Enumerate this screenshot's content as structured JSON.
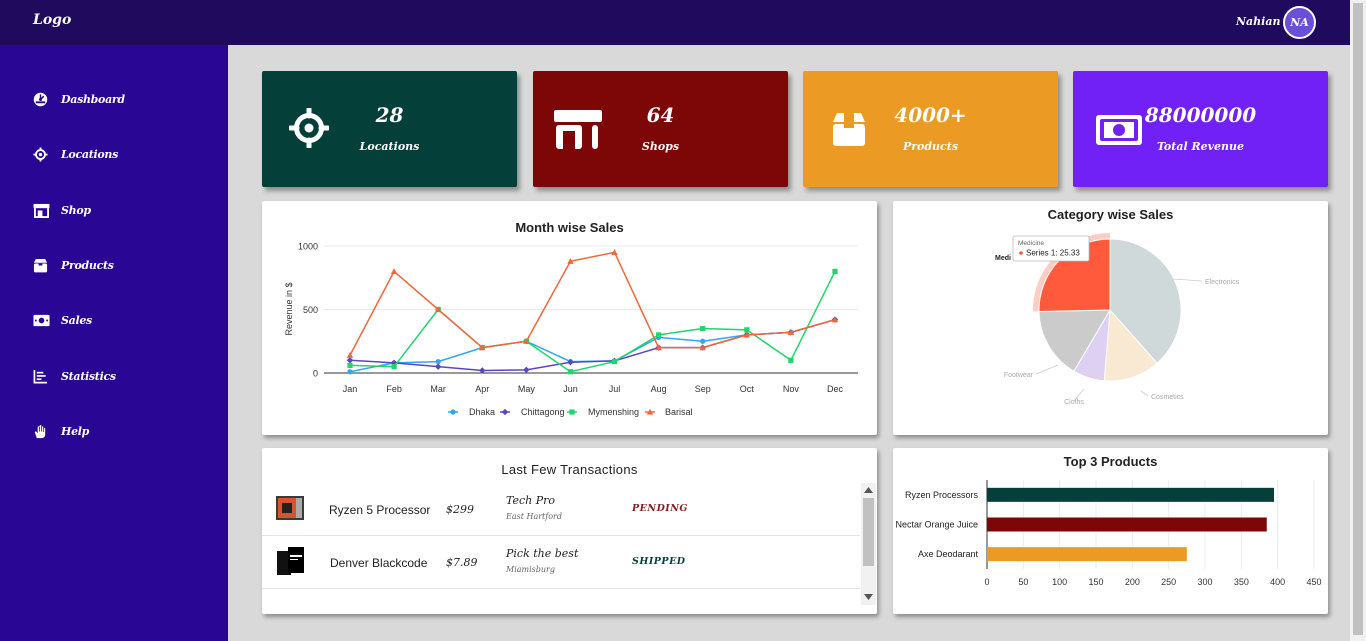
{
  "header": {
    "logo": "Logo",
    "user_name": "Nahian",
    "avatar_initials": "NA"
  },
  "sidebar": {
    "items": [
      {
        "label": "Dashboard",
        "icon": "dashboard-gauge-icon"
      },
      {
        "label": "Locations",
        "icon": "location-target-icon"
      },
      {
        "label": "Shop",
        "icon": "shop-icon"
      },
      {
        "label": "Products",
        "icon": "box-icon"
      },
      {
        "label": "Sales",
        "icon": "money-icon"
      },
      {
        "label": "Statistics",
        "icon": "chart-icon"
      },
      {
        "label": "Help",
        "icon": "hand-icon"
      }
    ]
  },
  "stats": [
    {
      "value": "28",
      "label": "Locations",
      "color": "#053f3a",
      "icon": "location-target-icon"
    },
    {
      "value": "64",
      "label": "Shops",
      "color": "#7d0606",
      "icon": "shop-icon"
    },
    {
      "value": "4000+",
      "label": "Products",
      "color": "#eb9b23",
      "icon": "box-icon"
    },
    {
      "value": "88000000",
      "label": "Total Revenue",
      "color": "#7121f5",
      "icon": "money-icon"
    }
  ],
  "colors": {
    "topbar": "#1f0a5e",
    "sidebar": "#2a0695",
    "background": "#d9d9d9"
  },
  "transactions": {
    "title": "Last Few Transactions",
    "rows": [
      {
        "product": "Ryzen 5 Processor",
        "price": "$299",
        "customer": "Tech Pro",
        "city": "East Hartford",
        "status": "PENDING",
        "status_color": "#8b1a1a"
      },
      {
        "product": "Denver Blackcode",
        "price": "$7.89",
        "customer": "Pick the best",
        "city": "Miamisburg",
        "status": "SHIPPED",
        "status_color": "#063f3a"
      }
    ]
  },
  "chart_data": [
    {
      "type": "line",
      "title": "Month wise Sales",
      "ylabel": "Revenue in $",
      "xlabel": "",
      "ylim": [
        0,
        1000
      ],
      "yticks": [
        0,
        500,
        1000
      ],
      "categories": [
        "Jan",
        "Feb",
        "Mar",
        "Apr",
        "May",
        "Jun",
        "Jul",
        "Aug",
        "Sep",
        "Oct",
        "Nov",
        "Dec"
      ],
      "legend": "bottom",
      "grid": true,
      "series": [
        {
          "name": "Dhaka",
          "color": "#2ea8f0",
          "marker": "circle",
          "values": [
            10,
            80,
            90,
            200,
            250,
            90,
            95,
            280,
            250,
            300,
            320,
            420
          ]
        },
        {
          "name": "Chittagong",
          "color": "#5a46c2",
          "marker": "diamond",
          "values": [
            100,
            80,
            50,
            20,
            25,
            85,
            95,
            200,
            200,
            300,
            320,
            420
          ]
        },
        {
          "name": "Mymenshing",
          "color": "#1ed66a",
          "marker": "square",
          "values": [
            60,
            50,
            500,
            200,
            250,
            10,
            90,
            300,
            350,
            340,
            100,
            800
          ]
        },
        {
          "name": "Barisal",
          "color": "#f0683a",
          "marker": "triangle",
          "values": [
            140,
            800,
            500,
            200,
            250,
            880,
            950,
            200,
            200,
            300,
            320,
            420
          ]
        }
      ]
    },
    {
      "type": "pie",
      "title": "Category wise Sales",
      "categories": [
        "Electronics",
        "Cosmetics",
        "Cloths",
        "Footwear",
        "Medicine"
      ],
      "values": [
        38.5,
        12.8,
        7.2,
        16.2,
        25.33
      ],
      "colors": [
        "#cfd9d9",
        "#f9e8d2",
        "#ddd0f2",
        "#cbcbcb",
        "#ff5a3c"
      ],
      "tooltip": {
        "category": "Medicine",
        "series": "Series 1",
        "value": "25.33",
        "text": "Series 1: 25.33"
      },
      "truncated_label": "Medi"
    },
    {
      "type": "bar",
      "orientation": "horizontal",
      "title": "Top 3 Products",
      "categories": [
        "Ryzen Processors",
        "Nectar Orange Juice",
        "Axe Deodarant"
      ],
      "values": [
        395,
        385,
        275
      ],
      "colors": [
        "#053f3a",
        "#7d0606",
        "#eb9b23"
      ],
      "xlim": [
        0,
        450
      ],
      "xticks": [
        0,
        50,
        100,
        150,
        200,
        250,
        300,
        350,
        400,
        450
      ],
      "grid": true
    }
  ]
}
